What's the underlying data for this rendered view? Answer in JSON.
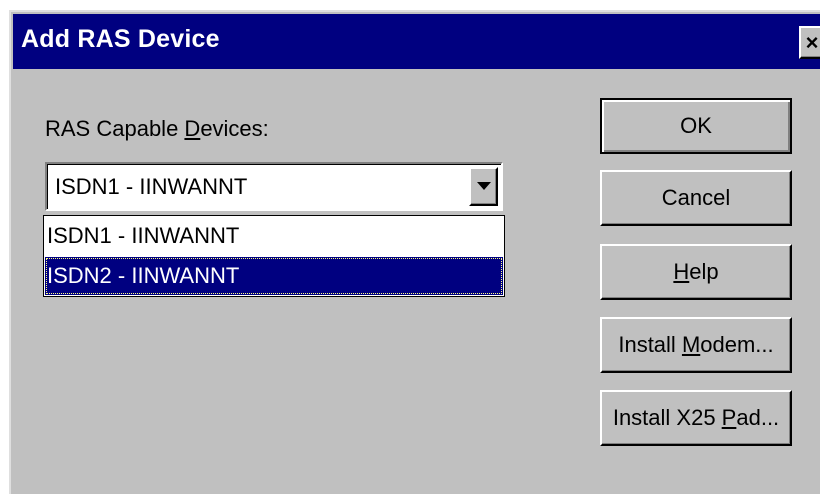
{
  "window": {
    "title": "Add RAS Device",
    "close_label": "×"
  },
  "devices": {
    "label_pre": "RAS Capable ",
    "label_acc": "D",
    "label_post": "evices:",
    "selected_value": "ISDN1 - IINWANNT",
    "options": [
      {
        "label": "ISDN1 - IINWANNT",
        "highlighted": false
      },
      {
        "label": "ISDN2 - IINWANNT",
        "highlighted": true
      }
    ]
  },
  "buttons": {
    "ok": {
      "label": "OK"
    },
    "cancel": {
      "label": "Cancel"
    },
    "help": {
      "pre": "",
      "acc": "H",
      "post": "elp"
    },
    "install_modem": {
      "pre": "Install ",
      "acc": "M",
      "post": "odem..."
    },
    "install_x25": {
      "pre": "Install X25 ",
      "acc": "P",
      "post": "ad..."
    }
  },
  "colors": {
    "titlebar": "#000080",
    "face": "#c0c0c0",
    "highlight": "#000080"
  },
  "icons": {
    "close": "close-icon",
    "dropdown": "chevron-down-icon"
  }
}
